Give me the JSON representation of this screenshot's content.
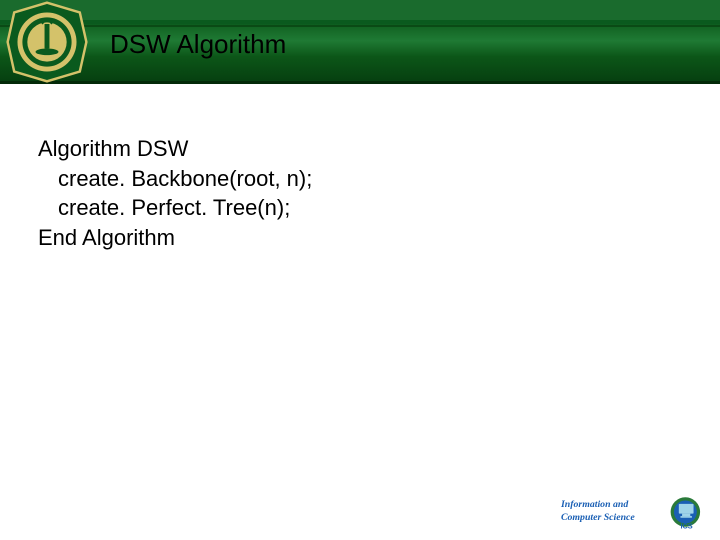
{
  "header": {
    "title": "DSW Algorithm",
    "logo_label": "university-seal"
  },
  "content": {
    "line1": "Algorithm DSW",
    "line2": "create. Backbone(root, n);",
    "line3": "create. Perfect. Tree(n);",
    "line4": "End Algorithm"
  },
  "footer": {
    "line1": "Information and",
    "line2": "Computer Science",
    "badge": "ICS"
  }
}
